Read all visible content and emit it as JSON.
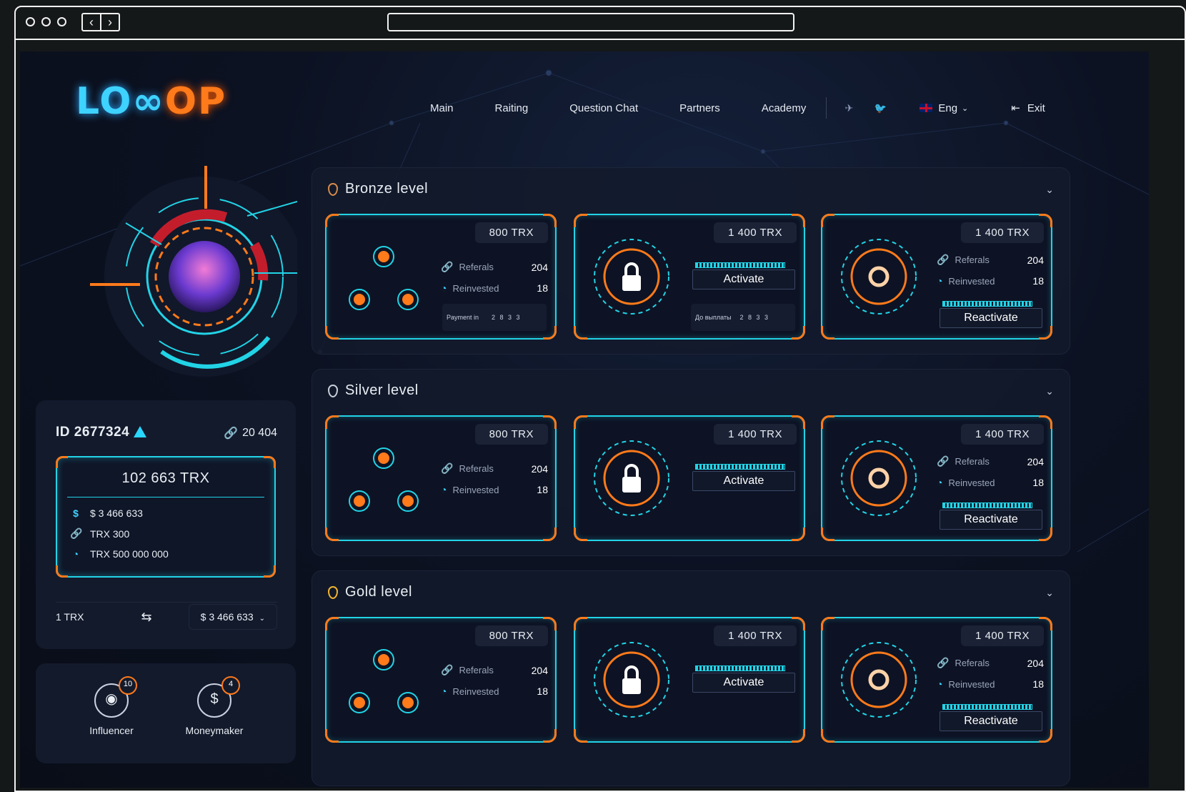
{
  "nav": {
    "items": [
      "Main",
      "Raiting",
      "Question Chat",
      "Partners",
      "Academy"
    ],
    "lang": "Eng",
    "exit": "Exit"
  },
  "logo": {
    "left": "LO",
    "right": "OP"
  },
  "user": {
    "id": "ID 2677324",
    "ref_count": "20 404",
    "balance_total": "102 663 TRX",
    "balance_usd": "$ 3 466 633",
    "balance_trx_ref": "TRX 300",
    "balance_trx_reinv": "TRX 500 000 000",
    "rate_left": "1 TRX",
    "rate_right": "$ 3 466 633"
  },
  "statuses": [
    {
      "label": "Influencer",
      "count": "10"
    },
    {
      "label": "Moneymaker",
      "count": "4"
    }
  ],
  "levels": [
    {
      "title": "Bronze level",
      "medal_color": "#d58a4b",
      "tiles": [
        {
          "price": "800 TRX",
          "kind": "stats",
          "referals_label": "Referals",
          "referals": "204",
          "reinvested_label": "Reinvested",
          "reinvested": "18",
          "pay_label": "Payment in",
          "pay_digits": "2 8 3 3"
        },
        {
          "price": "1 400 TRX",
          "kind": "lock",
          "button": "Activate",
          "pay_label": "До выплаты",
          "pay_digits": "2 8 3 3"
        },
        {
          "price": "1 400 TRX",
          "kind": "reactivate",
          "referals_label": "Referals",
          "referals": "204",
          "reinvested_label": "Reinvested",
          "reinvested": "18",
          "button": "Reactivate"
        }
      ]
    },
    {
      "title": "Silver level",
      "medal_color": "#c9cfd8",
      "tiles": [
        {
          "price": "800 TRX",
          "kind": "stats",
          "referals_label": "Referals",
          "referals": "204",
          "reinvested_label": "Reinvested",
          "reinvested": "18"
        },
        {
          "price": "1 400 TRX",
          "kind": "lock",
          "button": "Activate"
        },
        {
          "price": "1 400 TRX",
          "kind": "reactivate",
          "referals_label": "Referals",
          "referals": "204",
          "reinvested_label": "Reinvested",
          "reinvested": "18",
          "button": "Reactivate"
        }
      ]
    },
    {
      "title": "Gold level",
      "medal_color": "#f2b431",
      "tiles": [
        {
          "price": "800 TRX",
          "kind": "stats",
          "referals_label": "Referals",
          "referals": "204",
          "reinvested_label": "Reinvested",
          "reinvested": "18"
        },
        {
          "price": "1 400 TRX",
          "kind": "lock",
          "button": "Activate"
        },
        {
          "price": "1 400 TRX",
          "kind": "reactivate",
          "referals_label": "Referals",
          "referals": "204",
          "reinvested_label": "Reinvested",
          "reinvested": "18",
          "button": "Reactivate"
        }
      ]
    }
  ],
  "colors": {
    "accent_cyan": "#22d3e6",
    "accent_orange": "#ff7a1a",
    "bg": "#0c1222"
  }
}
